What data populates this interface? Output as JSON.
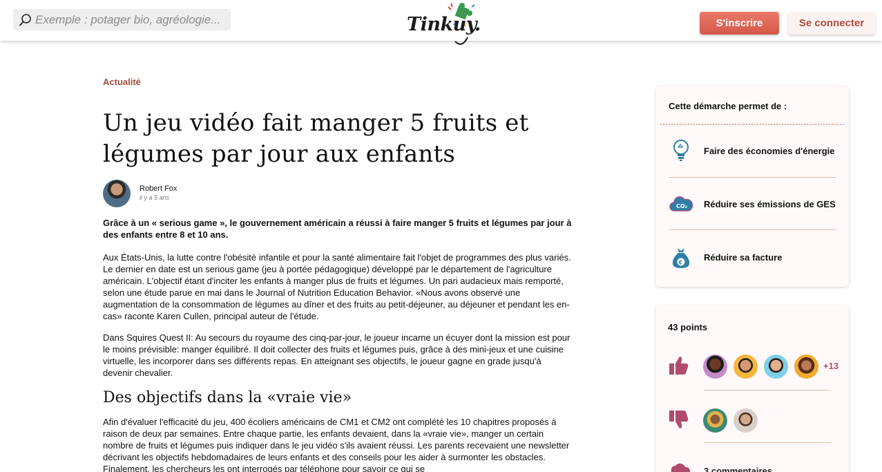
{
  "header": {
    "search_placeholder": "Exemple : potager bio, agréologie...",
    "logo_text": "Tinkuy.",
    "signup_label": "S'inscrire",
    "login_label": "Se connecter",
    "colors": {
      "signup": "#e06a5a",
      "login_text": "#b04b3e"
    }
  },
  "article": {
    "category": "Actualité",
    "title": "Un jeu vidéo fait manger 5 fruits et légumes par jour aux enfants",
    "author": {
      "name": "Robert Fox",
      "date": "il y a 5 ans"
    },
    "lead": "Grâce à un « serious game », le gouvernement américain a réussi à faire manger 5 fruits et légumes par jour à des enfants entre 8 et 10 ans.",
    "paragraph_1": "Aux États-Unis, la lutte contre l'obésité infantile et pour la santé alimentaire fait l'objet de programmes des plus variés. Le dernier en date est un serious game (jeu à portée pédagogique) développé par le département de l'agriculture américain. L'objectif étant d'inciter les enfants à manger plus de fruits et légumes. Un pari audacieux mais remporté, selon une étude parue en mai dans le Journal of Nutrition Education Behavior. «Nous avons observé une augmentation de la consommation de légumes au dîner et des fruits au petit-déjeuner, au déjeuner et pendant les en-cas» raconte Karen Cullen, principal auteur de l'étude.",
    "paragraph_2": "Dans Squires Quest II: Au secours du royaume des cinq-par-jour, le joueur incarne un écuyer dont la mission est pour le moins prévisible: manger équilibré. Il doit collecter des fruits et légumes puis, grâce à des mini-jeux et une cuisine virtuelle, les incorporer dans ses différents repas. En atteignant ses objectifs, le joueur gagne en grade jusqu'à devenir chevalier.",
    "subheading": "Des objectifs dans la «vraie vie»",
    "paragraph_3": "Afin d'évaluer l'efficacité du jeu, 400 écoliers américains de CM1 et CM2 ont complété les 10 chapitres proposés à raison de deux par semaines. Entre chaque partie, les enfants devaient, dans la «vraie vie», manger un certain nombre de fruits et légumes puis indiquer dans le jeu vidéo s'ils avaient réussi. Les parents recevaient une newsletter décrivant les objectifs hebdomadaires de leurs enfants et des conseils pour les aider à surmonter les obstacles. Finalement, les chercheurs les ont interrogés par téléphone pour savoir ce qui se"
  },
  "benefits": {
    "heading": "Cette démarche permet de :",
    "items": [
      {
        "label": "Faire des économies d'énergie",
        "icon": "lightbulb-icon"
      },
      {
        "label": "Réduire ses émissions de GES",
        "icon": "co2-cloud-icon"
      },
      {
        "label": "Réduire sa facture",
        "icon": "money-bag-icon"
      }
    ]
  },
  "votes": {
    "points": "43 points",
    "more_count": "+13",
    "comments_label": "3 commentaires",
    "accent_color": "#b04b6e"
  }
}
